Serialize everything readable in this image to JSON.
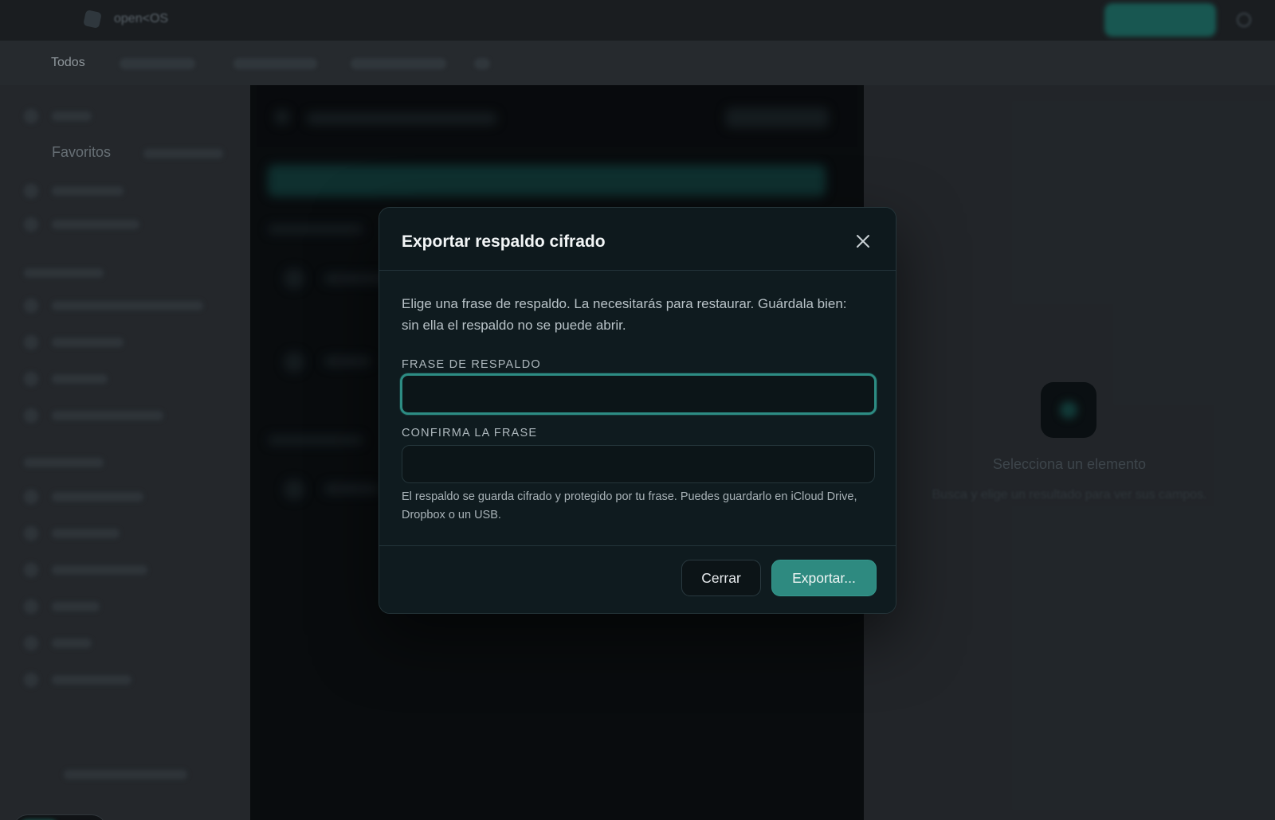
{
  "app": {
    "brand": "open<OS",
    "filters": {
      "all": "Todos"
    }
  },
  "sidebar": {
    "favorites_title": "Favoritos"
  },
  "detail": {
    "empty_title": "Selecciona un elemento",
    "empty_subtitle": "Busca y elige un resultado para ver sus campos."
  },
  "modal": {
    "title": "Exportar respaldo cifrado",
    "description": "Elige una frase de respaldo. La necesitarás para restaurar. Guárdala bien: sin ella el respaldo no se puede abrir.",
    "passphrase": {
      "label": "FRASE DE RESPALDO",
      "value": ""
    },
    "confirm": {
      "label": "CONFIRMA LA FRASE",
      "value": ""
    },
    "note": "El respaldo se guarda cifrado y protegido por tu frase. Puedes guardarlo en iCloud Drive, Dropbox o un USB.",
    "close_label": "Cerrar",
    "export_label": "Exportar..."
  },
  "colors": {
    "accent": "#2e8a80",
    "modal_bg": "#0f1b1f",
    "page_bg": "#2b2f34"
  },
  "icons": {
    "close": "close-icon",
    "logo": "logo-icon",
    "settings": "gear-icon"
  }
}
